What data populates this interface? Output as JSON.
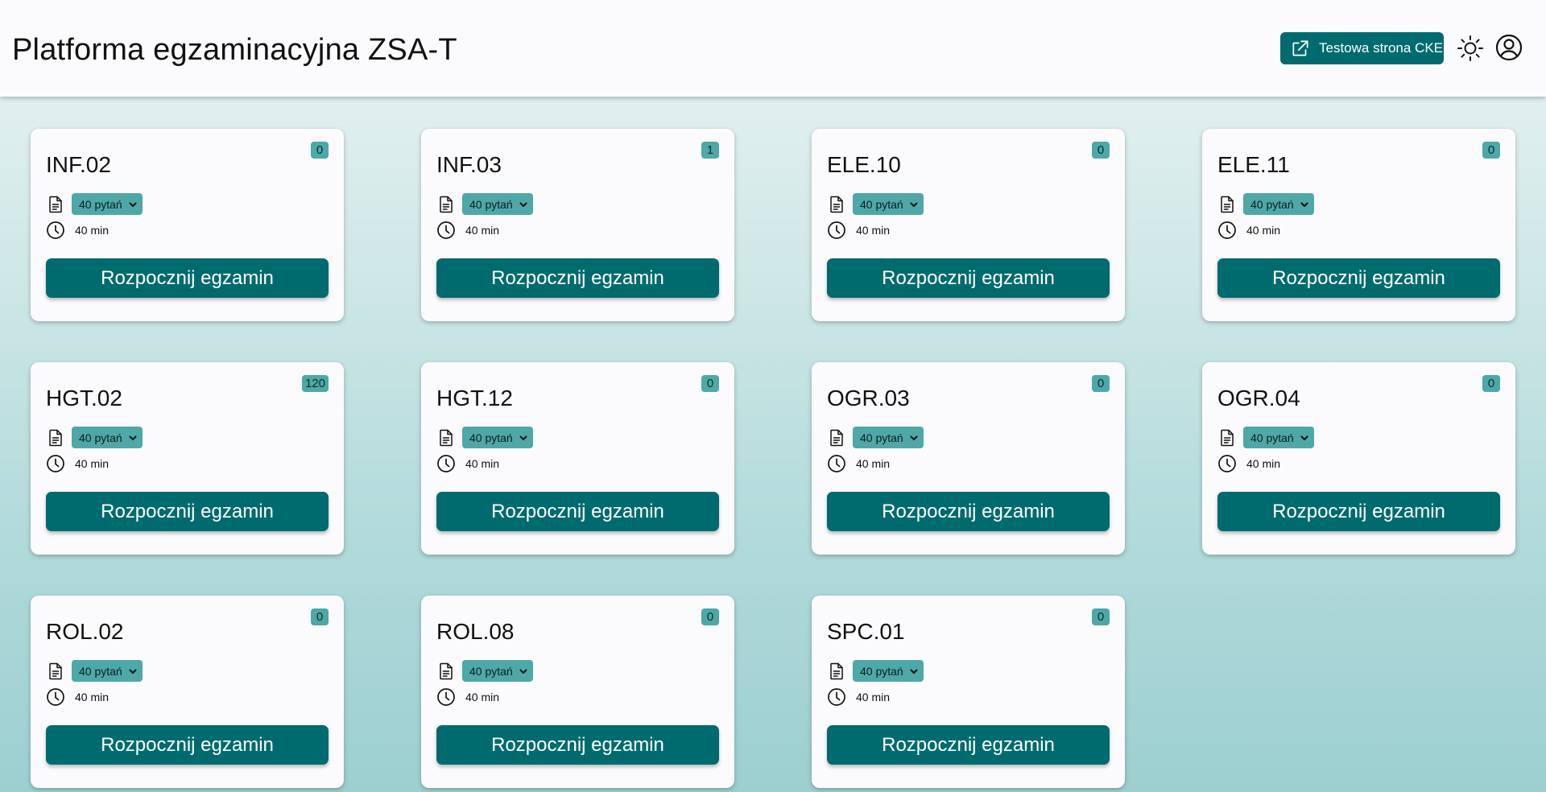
{
  "header": {
    "title": "Platforma egzaminacyjna ZSA-T",
    "cke_button_label": "Testowa strona CKE",
    "icons": {
      "external_link": "external-link-icon",
      "theme": "sun-icon",
      "account": "user-account-icon"
    }
  },
  "colors": {
    "primary": "#006b6e",
    "badge": "#4ea8a7",
    "card_bg": "#fbfbfd",
    "bg_top": "#eaf4f3",
    "bg_bottom": "#9dcfd1"
  },
  "cards": [
    {
      "code": "INF.02",
      "count": "0",
      "questions": "40 pytań",
      "time": "40 min",
      "button": "Rozpocznij egzamin"
    },
    {
      "code": "INF.03",
      "count": "1",
      "questions": "40 pytań",
      "time": "40 min",
      "button": "Rozpocznij egzamin"
    },
    {
      "code": "ELE.10",
      "count": "0",
      "questions": "40 pytań",
      "time": "40 min",
      "button": "Rozpocznij egzamin"
    },
    {
      "code": "ELE.11",
      "count": "0",
      "questions": "40 pytań",
      "time": "40 min",
      "button": "Rozpocznij egzamin"
    },
    {
      "code": "HGT.02",
      "count": "120",
      "questions": "40 pytań",
      "time": "40 min",
      "button": "Rozpocznij egzamin"
    },
    {
      "code": "HGT.12",
      "count": "0",
      "questions": "40 pytań",
      "time": "40 min",
      "button": "Rozpocznij egzamin"
    },
    {
      "code": "OGR.03",
      "count": "0",
      "questions": "40 pytań",
      "time": "40 min",
      "button": "Rozpocznij egzamin"
    },
    {
      "code": "OGR.04",
      "count": "0",
      "questions": "40 pytań",
      "time": "40 min",
      "button": "Rozpocznij egzamin"
    },
    {
      "code": "ROL.02",
      "count": "0",
      "questions": "40 pytań",
      "time": "40 min",
      "button": "Rozpocznij egzamin"
    },
    {
      "code": "ROL.08",
      "count": "0",
      "questions": "40 pytań",
      "time": "40 min",
      "button": "Rozpocznij egzamin"
    },
    {
      "code": "SPC.01",
      "count": "0",
      "questions": "40 pytań",
      "time": "40 min",
      "button": "Rozpocznij egzamin"
    }
  ]
}
